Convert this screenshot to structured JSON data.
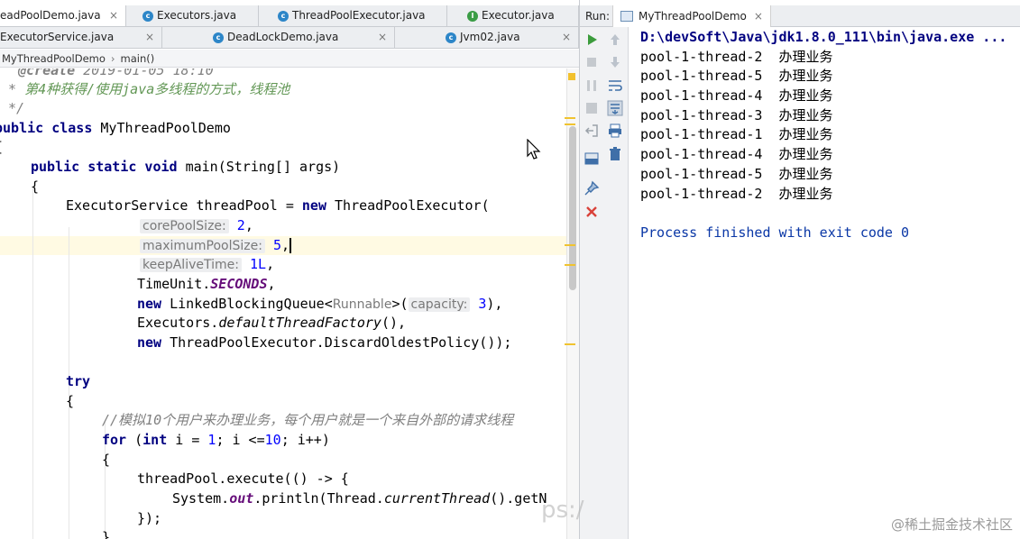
{
  "editor": {
    "tabs_row1": [
      {
        "label": "eadPoolDemo.java",
        "icon": "class-c-icon",
        "closable": true,
        "active": true
      },
      {
        "label": "Executors.java",
        "icon": "class-c-icon"
      },
      {
        "label": "ThreadPoolExecutor.java",
        "icon": "class-c-icon"
      },
      {
        "label": "Executor.java",
        "icon": "interface-i-icon"
      }
    ],
    "tabs_row2": [
      {
        "label": "ExecutorService.java",
        "icon": "interface-i-icon",
        "closable": true
      },
      {
        "label": "DeadLockDemo.java",
        "icon": "class-c-icon",
        "closable": true
      },
      {
        "label": "Jvm02.java",
        "icon": "class-c-icon",
        "closable": true
      }
    ],
    "close_glyph": "×",
    "breadcrumb": [
      "MyThreadPoolDemo",
      "main()"
    ],
    "breadcrumb_sep": "›",
    "code": {
      "l1_tag": "@create",
      "l1_rest": " 2019-01-05 18:10",
      "l2_star": " * ",
      "l2_text": "第4种获得/使用java多线程的方式，线程池",
      "l3": " */",
      "l4_kw": "public class",
      "l4_rest": " MyThreadPoolDemo",
      "l5": "{",
      "l6_kw": "public static void",
      "l6_rest": " main(String[] args)",
      "l7": "{",
      "l8_a": "ExecutorService threadPool = ",
      "l8_kw": "new",
      "l8_b": " ThreadPoolExecutor(",
      "p1_hint": "corePoolSize:",
      "p1_val": "2",
      "p2_hint": "maximumPoolSize:",
      "p2_val": "5",
      "p3_hint": "keepAliveTime:",
      "p3_val": "1L",
      "p4_a": "TimeUnit.",
      "p4_field": "SECONDS",
      "p5_kw": "new",
      "p5_a": " LinkedBlockingQueue<",
      "p5_type": "Runnable",
      "p5_b": ">(",
      "p5_hint": "capacity:",
      "p5_val": "3",
      "p5_end": "),",
      "p6_a": "Executors.",
      "p6_m": "defaultThreadFactory",
      "p6_b": "(),",
      "p7_kw": "new",
      "p7_a": " ThreadPoolExecutor.DiscardOldestPolicy());",
      "try_kw": "try",
      "brace_open": "{",
      "comment": "//模拟10个用户来办理业务，每个用户就是一个来自外部的请求线程",
      "for_kw": "for",
      "for_a": " (",
      "for_int": "int",
      "for_b": " i = ",
      "for_one": "1",
      "for_c": "; i <=",
      "for_ten": "10",
      "for_d": "; i++)",
      "exec": "threadPool.execute(() -> {",
      "print_a": "System.",
      "print_out": "out",
      "print_b": ".println(Thread.",
      "print_m": "currentThread",
      "print_c": "().getN",
      "close_lambda": "});",
      "close_brace": "}"
    }
  },
  "run": {
    "label": "Run:",
    "tab_title": "MyThreadPoolDemo",
    "console_lines": [
      "D:\\devSoft\\Java\\jdk1.8.0_111\\bin\\java.exe ...",
      "pool-1-thread-2  办理业务",
      "pool-1-thread-5  办理业务",
      "pool-1-thread-4  办理业务",
      "pool-1-thread-3  办理业务",
      "pool-1-thread-1  办理业务",
      "pool-1-thread-4  办理业务",
      "pool-1-thread-5  办理业务",
      "pool-1-thread-2  办理业务",
      "",
      "Process finished with exit code 0"
    ],
    "toolbar_icons": [
      "rerun-icon",
      "up-arrow-icon",
      "stop-icon",
      "down-arrow-icon",
      "pause-icon",
      "soft-wrap-icon",
      "dump-threads-icon",
      "scroll-to-end-icon",
      "exit-icon",
      "print-icon",
      "layout-icon",
      "trash-icon",
      "pin-icon",
      "close-icon"
    ]
  },
  "watermark": "@稀土掘金技术社区",
  "ghost_text": "ps:/",
  "colors": {
    "run_green": "#3c9c3c",
    "stop_red": "#d9423a",
    "gutter_mark": "#f0c330"
  }
}
